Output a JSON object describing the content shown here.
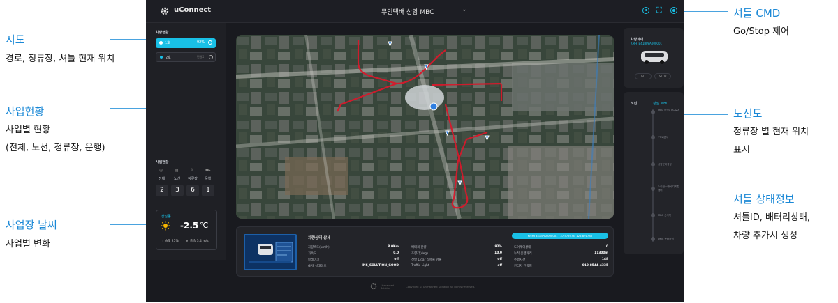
{
  "app": {
    "brand": "uConnect",
    "title": "무인택배 상암 MBC"
  },
  "sidebar": {
    "vehicle_status_title": "차량현황",
    "vehicles": [
      {
        "label": "1호",
        "battery": "92%"
      },
      {
        "label": "2호",
        "status": "전원X"
      }
    ],
    "business_title": "사업현황",
    "business_cols": [
      {
        "label": "전체",
        "value": "2"
      },
      {
        "label": "노선",
        "value": "3"
      },
      {
        "label": "정류장",
        "value": "6"
      },
      {
        "label": "운행",
        "value": "1"
      }
    ],
    "weather": {
      "location": "상암동",
      "temperature": "-2.5",
      "unit": "℃",
      "humidity": "습도 25%",
      "wind": "풍속 3.4 m/s"
    }
  },
  "right_panel": {
    "vehicle_control_title": "차량제어",
    "vehicle_id": "KMHTB41BP8A000001",
    "go_label": "GO",
    "stop_label": "STOP",
    "route_label": "노선",
    "route_name": "상암 MBC",
    "stops": [
      "MBC 메인1 PLAZA",
      "YTN 본사",
      "상암문화광장",
      "누리꿈스퀘어 디지털센터",
      "MBC 신사옥",
      "DMC 문화공원"
    ]
  },
  "detail": {
    "title": "차량상태 상세",
    "id_badge": "KMHTB41BP8A000001 | 37.579574, 126.891785",
    "col1": [
      {
        "label": "차량속도(km/h)",
        "value": "8.0Km"
      },
      {
        "label": "가속도",
        "value": "0.0"
      },
      {
        "label": "브레이크",
        "value": "off"
      },
      {
        "label": "GPS 상태정보",
        "value": "INS_SOLUTION_GOOD"
      }
    ],
    "col2": [
      {
        "label": "배터리 잔량",
        "value": "92%"
      },
      {
        "label": "조향각(deg)",
        "value": "10.0"
      },
      {
        "label": "전방 Lidar 장애물 검출",
        "value": "off"
      },
      {
        "label": "Traffic Light",
        "value": "off"
      }
    ],
    "col3": [
      {
        "label": "도어제어상태",
        "value": "0"
      },
      {
        "label": "누적 운행거리",
        "value": "11300m"
      },
      {
        "label": "주행시간",
        "value": "148"
      },
      {
        "label": "관리자 연락처",
        "value": "010-8544-4335"
      }
    ]
  },
  "footer": {
    "logo_text": "Unmanned Solution",
    "copyright": "Copyright © Unmanned Solution All rights reserved."
  },
  "annotations": [
    {
      "title": "지도",
      "lines": [
        "경로, 정류장, 셔틀 현재 위치"
      ]
    },
    {
      "title": "사업현황",
      "lines": [
        "사업별 현황",
        "(전체, 노선, 정류장, 운행)"
      ]
    },
    {
      "title": "사업장 날씨",
      "lines": [
        "사업별 변화"
      ]
    },
    {
      "title": "셔틀 CMD",
      "lines": [
        "Go/Stop 제어"
      ]
    },
    {
      "title": "노선도",
      "lines": [
        "정류장 별 현재 위치",
        "표시"
      ]
    },
    {
      "title": "셔틀 상태정보",
      "lines": [
        "셔틀ID, 배터리상태,",
        "차량 추가시 생성"
      ]
    }
  ]
}
